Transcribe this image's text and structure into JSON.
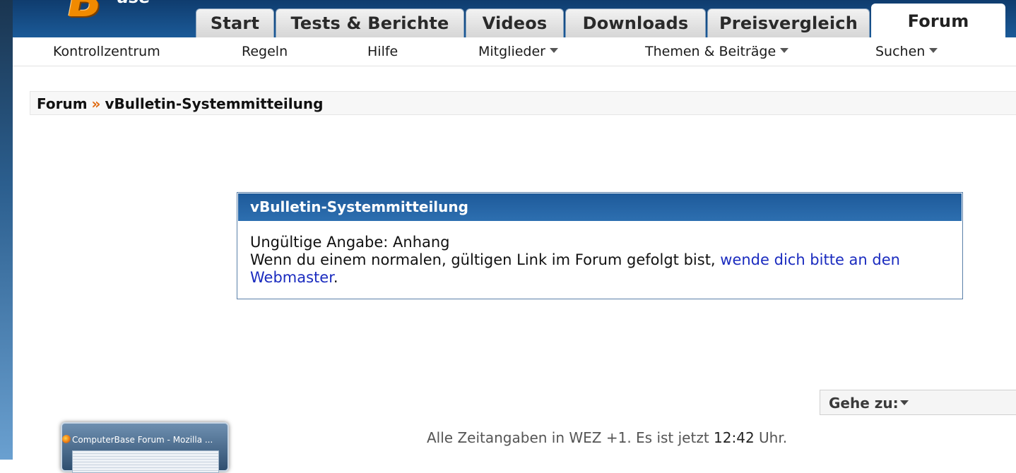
{
  "tabs": [
    {
      "label": "Start"
    },
    {
      "label": "Tests & Berichte"
    },
    {
      "label": "Videos"
    },
    {
      "label": "Downloads"
    },
    {
      "label": "Preisvergleich"
    },
    {
      "label": "Forum",
      "active": true
    }
  ],
  "subnav": [
    {
      "label": "Kontrollzentrum"
    },
    {
      "label": "Regeln"
    },
    {
      "label": "Hilfe"
    },
    {
      "label": "Mitglieder",
      "dropdown": true
    },
    {
      "label": "Themen & Beiträge",
      "dropdown": true
    },
    {
      "label": "Suchen",
      "dropdown": true
    }
  ],
  "breadcrumb": {
    "root": "Forum",
    "separator": "»",
    "current": "vBulletin-Systemmitteilung"
  },
  "message": {
    "title": "vBulletin-Systemmitteilung",
    "line1": "Ungültige Angabe: Anhang",
    "line2_prefix": "Wenn du einem normalen, gültigen Link im Forum gefolgt bist, ",
    "link_text": "wende dich bitte an den Webmaster",
    "line2_suffix": "."
  },
  "goto": {
    "label": "Gehe zu:"
  },
  "footer": {
    "prefix": "Alle Zeitangaben in WEZ +1. Es ist jetzt ",
    "time": "12:42",
    "suffix": " Uhr."
  },
  "taskbar_thumbnail": {
    "title": "ComputerBase Forum - Mozilla ..."
  },
  "colors": {
    "header_blue": "#1b5a98",
    "panel_head_blue": "#2d6fb0",
    "breadcrumb_separator": "#e06a10",
    "link": "#1a2bbf"
  }
}
